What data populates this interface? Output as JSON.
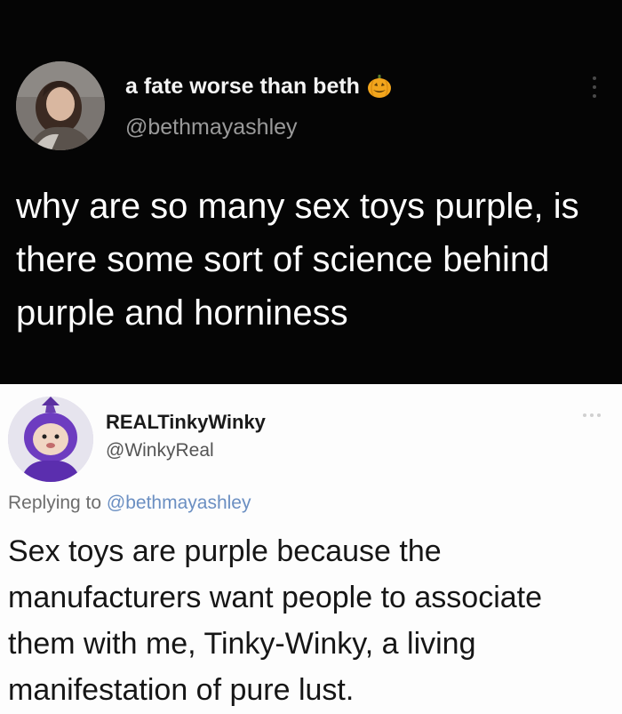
{
  "original_tweet": {
    "display_name": "a fate worse than beth",
    "name_emoji_icon": "jack-o-lantern-icon",
    "handle": "@bethmayashley",
    "text": "why are so many sex toys purple, is there some sort of science behind purple and horniness",
    "background_color": "#050505"
  },
  "reply_tweet": {
    "display_name": "REALTinkyWinky",
    "handle": "@WinkyReal",
    "replying_prefix": "Replying to",
    "replying_handle": "@bethmayashley",
    "text": "Sex toys are purple because the manufacturers want people to associate them with me, Tinky-Winky, a living manifestation of pure lust.",
    "background_color": "#fdfdfd",
    "mention_color": "#6b8fc2"
  }
}
